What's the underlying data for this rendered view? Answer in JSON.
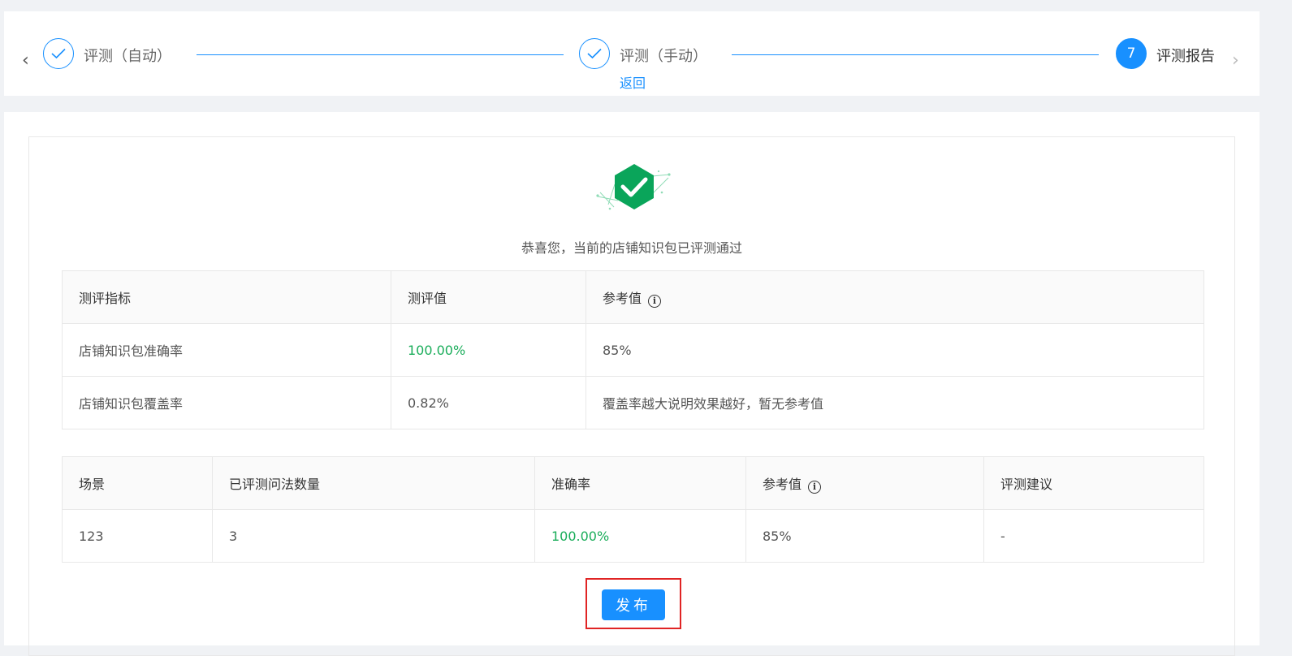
{
  "steps": {
    "items": [
      {
        "title": "评测（自动）",
        "status": "done"
      },
      {
        "title": "评测（手动）",
        "status": "done",
        "link": "返回"
      },
      {
        "title": "评测报告",
        "status": "active",
        "number": "7"
      }
    ]
  },
  "report": {
    "success_message": "恭喜您，当前的店铺知识包已评测通过",
    "metrics_table": {
      "headers": [
        "测评指标",
        "测评值",
        "参考值"
      ],
      "rows": [
        {
          "metric": "店铺知识包准确率",
          "value": "100.00%",
          "reference": "85%"
        },
        {
          "metric": "店铺知识包覆盖率",
          "value": "0.82%",
          "reference": "覆盖率越大说明效果越好，暂无参考值"
        }
      ]
    },
    "scene_table": {
      "headers": [
        "场景",
        "已评测问法数量",
        "准确率",
        "参考值",
        "评测建议"
      ],
      "rows": [
        {
          "scene": "123",
          "count": "3",
          "accuracy": "100.00%",
          "reference": "85%",
          "suggestion": "-"
        }
      ]
    },
    "publish_label": "发布"
  },
  "colors": {
    "primary": "#1890ff",
    "success": "#1aad5a",
    "highlight_frame": "#e02424"
  }
}
